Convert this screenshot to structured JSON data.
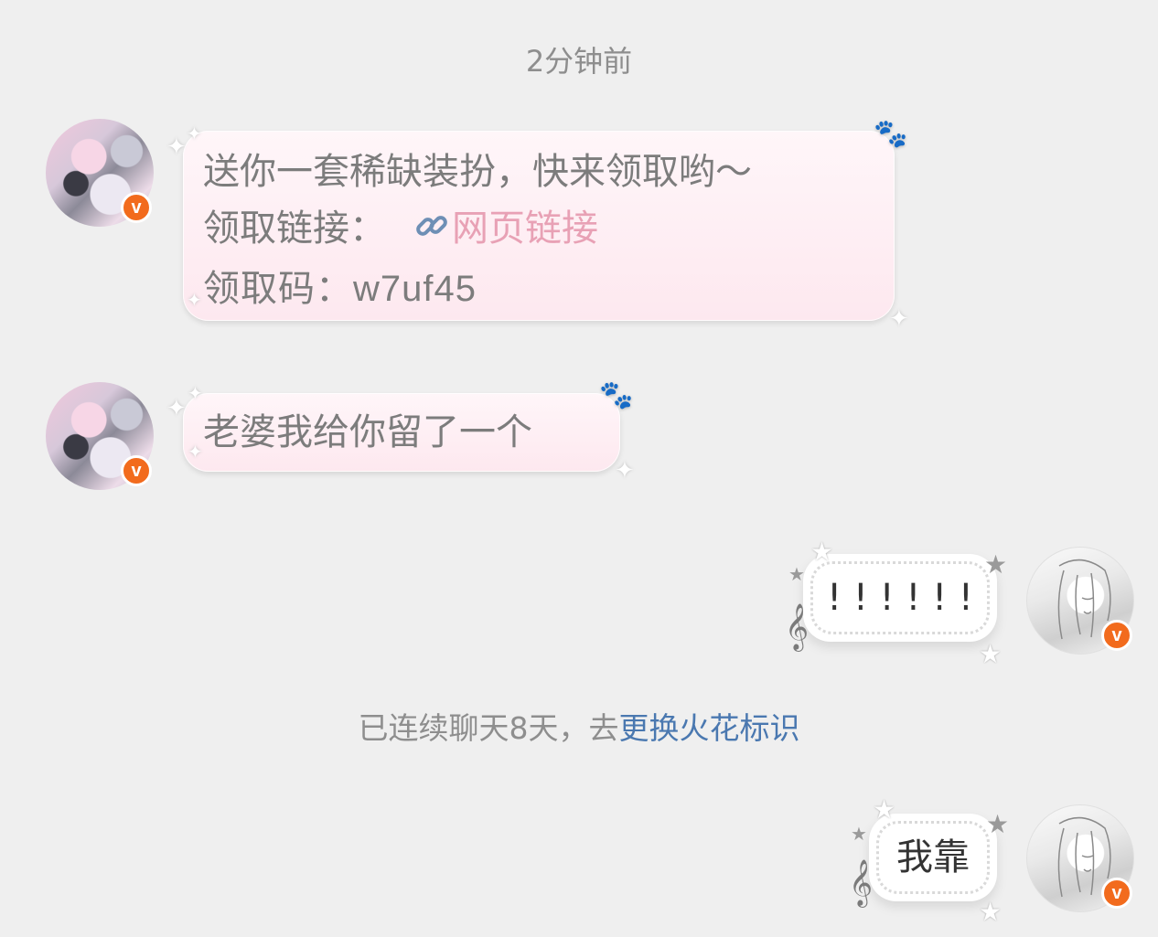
{
  "timestamp": "2分钟前",
  "messages": [
    {
      "sender": "other",
      "lines": {
        "line1": "送你一套稀缺装扮，快来领取哟～",
        "line2_label": "领取链接：",
        "line2_link": "网页链接",
        "line3": "领取码：w7uf45"
      }
    },
    {
      "sender": "other",
      "text": "老婆我给你留了一个"
    },
    {
      "sender": "me",
      "text": "! ! ! ! ! !"
    },
    {
      "sender": "me",
      "text": "我靠"
    }
  ],
  "system_note": {
    "prefix": "已连续聊天8天，去",
    "action": "更换火花标识"
  },
  "badge_letter": "v",
  "icons": {
    "link": "link-icon",
    "badge": "verified-v-badge",
    "paw": "paw-icon",
    "sparkle": "sparkle-icon",
    "star": "star-icon",
    "music": "treble-clef-icon"
  },
  "colors": {
    "background": "#efefef",
    "pink_bubble": "#fde8ef",
    "link": "#e8a1b5",
    "action_link": "#4a78b0",
    "badge": "#f26b1d"
  }
}
